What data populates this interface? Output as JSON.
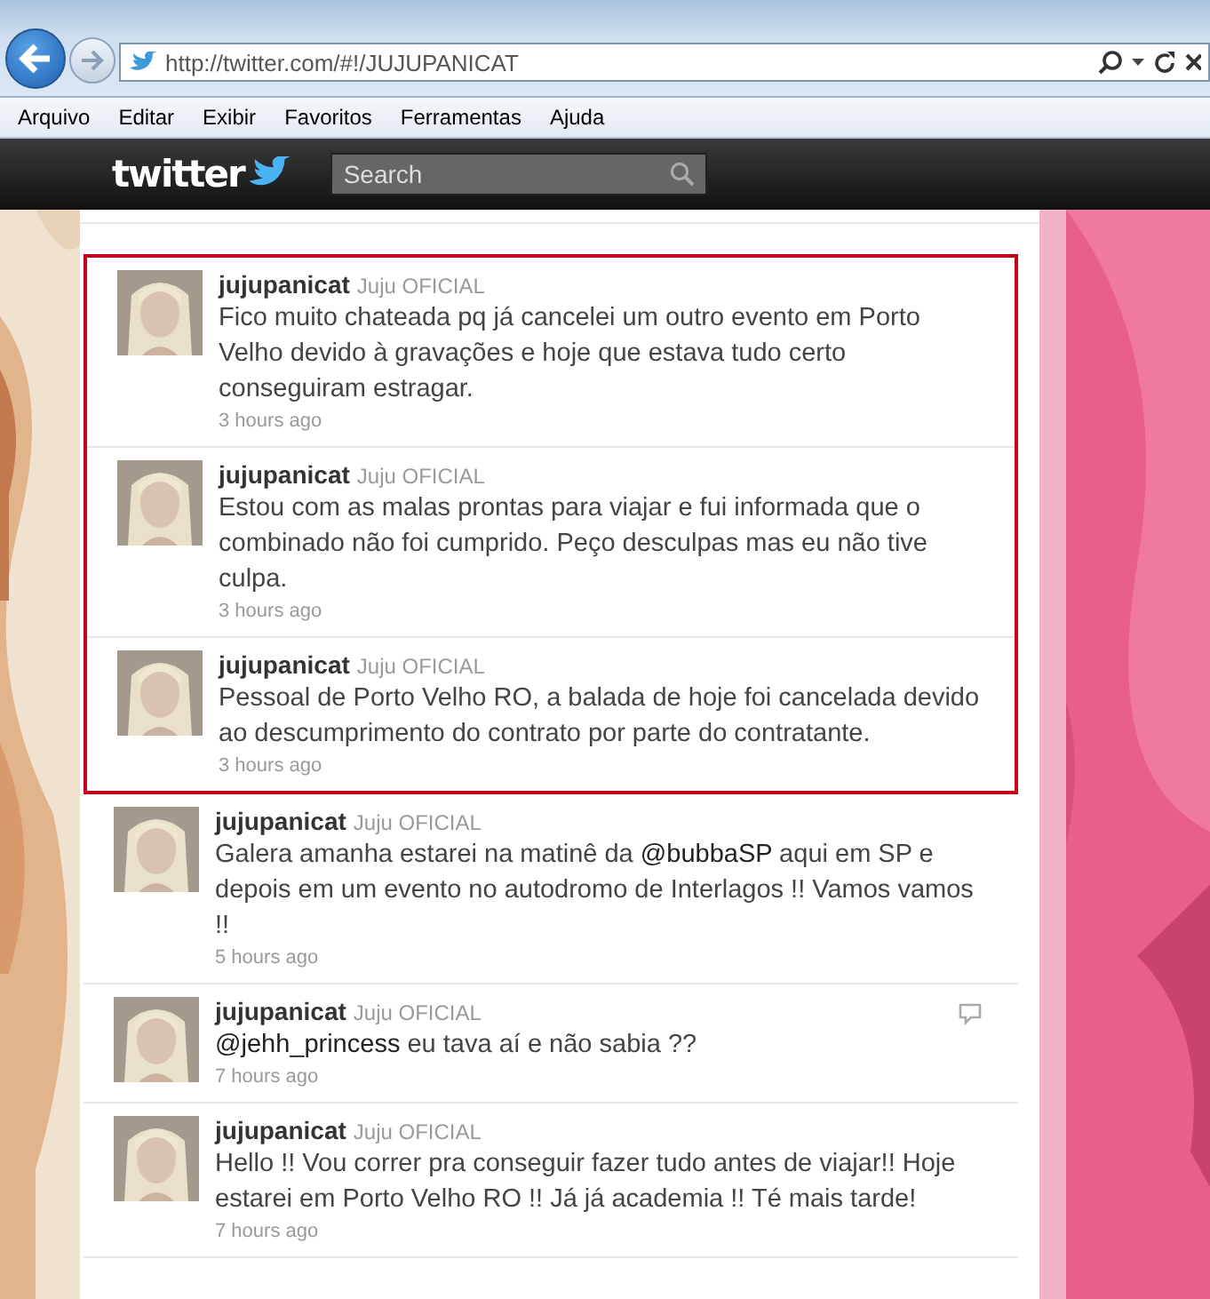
{
  "browser": {
    "address": "http://twitter.com/#!/JUJUPANICAT",
    "menu": [
      "Arquivo",
      "Editar",
      "Exibir",
      "Favoritos",
      "Ferramentas",
      "Ajuda"
    ]
  },
  "header": {
    "logo": "twitter",
    "search": {
      "placeholder": "Search"
    }
  },
  "tweets": [
    {
      "user": "jujupanicat",
      "display_name": "Juju OFICIAL",
      "highlighted": true,
      "hovered": false,
      "text": [
        {
          "kind": "plain",
          "text": "Fico muito chateada pq já cancelei um outro evento em Porto Velho devido à gravações e hoje que estava tudo certo conseguiram estragar."
        }
      ],
      "time": "3 hours ago"
    },
    {
      "user": "jujupanicat",
      "display_name": "Juju OFICIAL",
      "highlighted": true,
      "hovered": false,
      "text": [
        {
          "kind": "plain",
          "text": "Estou com as malas prontas para viajar e fui informada que o combinado não foi cumprido. Peço desculpas mas eu não tive culpa."
        }
      ],
      "time": "3 hours ago"
    },
    {
      "user": "jujupanicat",
      "display_name": "Juju OFICIAL",
      "highlighted": true,
      "hovered": false,
      "text": [
        {
          "kind": "plain",
          "text": "Pessoal de Porto Velho RO, a balada de hoje foi cancelada devido ao descumprimento do contrato por parte do contratante."
        }
      ],
      "time": "3 hours ago"
    },
    {
      "user": "jujupanicat",
      "display_name": "Juju OFICIAL",
      "highlighted": false,
      "hovered": false,
      "text": [
        {
          "kind": "plain",
          "text": "Galera amanha estarei na matinê da "
        },
        {
          "kind": "mention",
          "text": "@bubbaSP"
        },
        {
          "kind": "plain",
          "text": " aqui em SP e depois em um evento no autodromo de Interlagos !! Vamos vamos !!"
        }
      ],
      "time": "5 hours ago"
    },
    {
      "user": "jujupanicat",
      "display_name": "Juju OFICIAL",
      "highlighted": false,
      "hovered": true,
      "text": [
        {
          "kind": "mention",
          "text": "@jehh_princess"
        },
        {
          "kind": "plain",
          "text": " eu tava aí e não sabia ??"
        }
      ],
      "time": "7 hours ago"
    },
    {
      "user": "jujupanicat",
      "display_name": "Juju OFICIAL",
      "highlighted": false,
      "hovered": false,
      "text": [
        {
          "kind": "plain",
          "text": "Hello !! Vou correr pra conseguir fazer tudo antes de viajar!! Hoje estarei em Porto Velho RO !! Já já academia !! Té mais tarde!"
        }
      ],
      "time": "7 hours ago"
    }
  ]
}
